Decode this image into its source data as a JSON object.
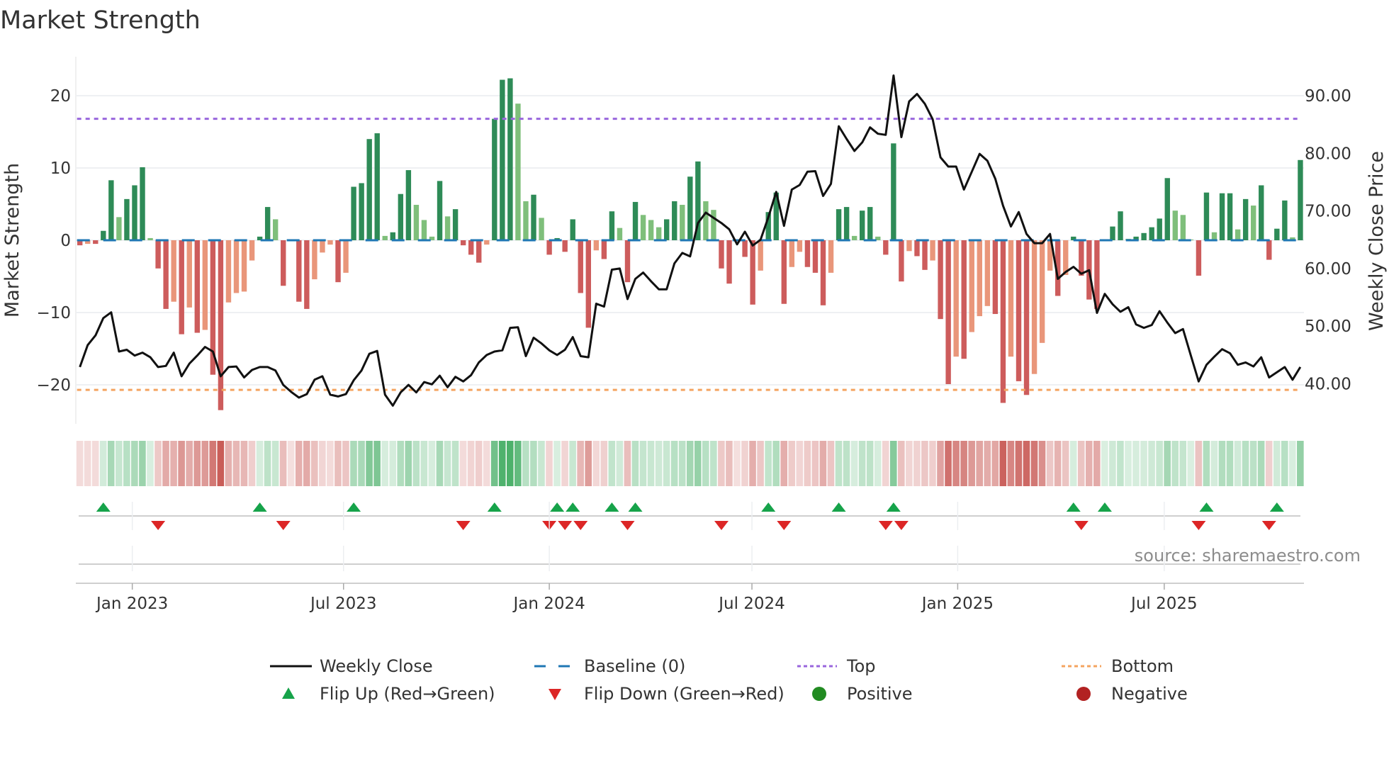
{
  "chart_data": {
    "type": "bar",
    "title": "Market Strength",
    "ylabel": "Market Strength",
    "y2label": "Weekly Close Price",
    "ylim": [
      -25,
      25.5
    ],
    "y2lim": [
      33,
      100
    ],
    "yticks": [
      20,
      10,
      0,
      -10,
      -20
    ],
    "ytick_labels": [
      "20",
      "10",
      "0",
      "−10",
      "−20"
    ],
    "y2ticks": [
      90,
      80,
      70,
      60,
      50,
      40
    ],
    "y2tick_labels": [
      "90.00",
      "80.00",
      "70.00",
      "60.00",
      "50.00",
      "40.00"
    ],
    "x_unit": "week index",
    "xticks": [
      {
        "label": "Jan 2023",
        "week": 6.7
      },
      {
        "label": "Jul 2023",
        "week": 33.7
      },
      {
        "label": "Jan 2024",
        "week": 60.0
      },
      {
        "label": "Jul 2024",
        "week": 85.9
      },
      {
        "label": "Jan 2025",
        "week": 112.2
      },
      {
        "label": "Jul 2025",
        "week": 138.6
      }
    ],
    "top_level": 16.8,
    "bottom_level": -20.7,
    "baseline": 0,
    "grid": true,
    "legend_position": "bottom",
    "series": [
      {
        "name": "Market Strength",
        "type": "bar",
        "values": [
          -0.7,
          -0.5,
          -0.5,
          1.3,
          8.3,
          3.2,
          5.7,
          7.6,
          10.1,
          0.3,
          -3.9,
          -9.5,
          -8.5,
          -13,
          -9.3,
          -12.8,
          -12.4,
          -18.6,
          -23.5,
          -8.6,
          -7.3,
          -7.1,
          -2.8,
          0.5,
          4.6,
          2.9,
          -6.3,
          -0.1,
          -8.5,
          -9.5,
          -5.4,
          -1.7,
          -0.6,
          -5.8,
          -4.5,
          7.4,
          7.9,
          14,
          14.8,
          0.6,
          1.1,
          6.4,
          9.7,
          4.9,
          2.8,
          0.5,
          8.2,
          3.3,
          4.3,
          -0.7,
          -2.0,
          -3.1,
          -0.6,
          16.8,
          22.2,
          22.4,
          18.9,
          5.4,
          6.3,
          3.1,
          -2.0,
          0.3,
          -1.6,
          2.9,
          -7.3,
          -12.1,
          -1.4,
          -2.6,
          4.0,
          1.7,
          -5.8,
          5.3,
          3.5,
          2.8,
          1.8,
          2.9,
          5.4,
          4.9,
          8.8,
          10.9,
          5.4,
          4.2,
          -3.9,
          -6.0,
          -0.1,
          -2.3,
          -8.9,
          -4.2,
          3.9,
          6.6,
          -8.8,
          -3.7,
          -1.6,
          -3.7,
          -4.5,
          -9.0,
          -4.5,
          4.3,
          4.6,
          0.6,
          4.1,
          4.6,
          0.5,
          -2.0,
          13.4,
          -5.7,
          -1.5,
          -2.2,
          -4.1,
          -2.8,
          -10.9,
          -19.9,
          -16.1,
          -16.4,
          -12.7,
          -10.5,
          -9.1,
          -10.2,
          -22.5,
          -16.1,
          -19.5,
          -21.4,
          -18.5,
          -14.2,
          -4.2,
          -7.7,
          -4.8,
          0.5,
          -4.9,
          -8.2,
          -9.5,
          0.1,
          1.9,
          4.0,
          0.2,
          0.5,
          1.0,
          1.8,
          3.0,
          8.6,
          4.1,
          3.5,
          0.1,
          -4.9,
          6.6,
          1.1,
          6.5,
          6.5,
          1.5,
          5.7,
          4.8,
          7.6,
          -2.7,
          1.6,
          5.5,
          0.4,
          11.1
        ]
      },
      {
        "name": "Weekly Close",
        "type": "line",
        "axis": "right",
        "values": [
          42.9,
          46.7,
          48.4,
          51.4,
          52.4,
          45.6,
          45.9,
          44.9,
          45.4,
          44.6,
          42.9,
          43.1,
          45.4,
          41.3,
          43.5,
          44.9,
          46.4,
          45.6,
          41.3,
          42.9,
          43.0,
          41.1,
          42.4,
          42.9,
          42.9,
          42.3,
          39.8,
          38.6,
          37.6,
          38.2,
          40.7,
          41.3,
          38.1,
          37.8,
          38.2,
          40.6,
          42.3,
          45.2,
          45.7,
          38.1,
          36.2,
          38.5,
          39.8,
          38.5,
          40.3,
          39.9,
          41.4,
          39.4,
          41.2,
          40.4,
          41.5,
          43.7,
          45.0,
          45.6,
          45.8,
          49.7,
          49.8,
          44.8,
          48.0,
          47.0,
          45.8,
          45.0,
          45.9,
          48.1,
          44.8,
          44.6,
          53.9,
          53.4,
          59.8,
          60.0,
          54.7,
          58.2,
          59.3,
          57.8,
          56.4,
          56.4,
          60.9,
          62.7,
          62.1,
          67.9,
          69.7,
          68.8,
          67.9,
          66.8,
          64.2,
          66.4,
          64.0,
          65.0,
          68.9,
          73.3,
          67.4,
          73.7,
          74.5,
          76.8,
          76.9,
          72.6,
          74.7,
          84.7,
          82.5,
          80.4,
          81.9,
          84.5,
          83.4,
          83.2,
          93.5,
          82.8,
          89.0,
          90.3,
          88.6,
          85.9,
          79.3,
          77.7,
          77.7,
          73.7,
          76.8,
          79.9,
          78.7,
          75.6,
          70.9,
          67.3,
          69.8,
          66.0,
          64.4,
          64.4,
          66.0,
          58.2,
          59.4,
          60.3,
          59.1,
          59.7,
          52.3,
          55.6,
          53.8,
          52.5,
          53.3,
          50.3,
          49.7,
          50.2,
          52.6,
          50.6,
          48.8,
          49.5,
          44.9,
          40.4,
          43.3,
          44.7,
          46.0,
          45.3,
          43.3,
          43.7,
          43.0,
          44.6,
          41.1,
          42.0,
          42.9,
          40.7,
          42.9
        ]
      }
    ],
    "legend": [
      {
        "label": "Weekly Close",
        "symbol": "line"
      },
      {
        "label": "Baseline (0)",
        "symbol": "dash"
      },
      {
        "label": "Top",
        "symbol": "dot-purple"
      },
      {
        "label": "Bottom",
        "symbol": "dot-orange"
      },
      {
        "label": "Flip Up (Red→Green)",
        "symbol": "triangle-up"
      },
      {
        "label": "Flip Down (Green→Red)",
        "symbol": "triangle-down"
      },
      {
        "label": "Positive",
        "symbol": "circle-green"
      },
      {
        "label": "Negative",
        "symbol": "circle-red"
      }
    ],
    "annotation": "source: sharemaestro.com"
  },
  "colors": {
    "pos_strong": "#2e8b57",
    "pos_weak": "#7fbf7b",
    "neg_strong": "#cd5c5c",
    "neg_weak": "#e9967a",
    "baseline": "#1f77b4",
    "top": "#9966dd",
    "bottom": "#f4a460",
    "line": "#111111",
    "flip_up": "#16a34a",
    "flip_down": "#dc2626",
    "positive": "#228b22",
    "negative": "#b22222"
  }
}
